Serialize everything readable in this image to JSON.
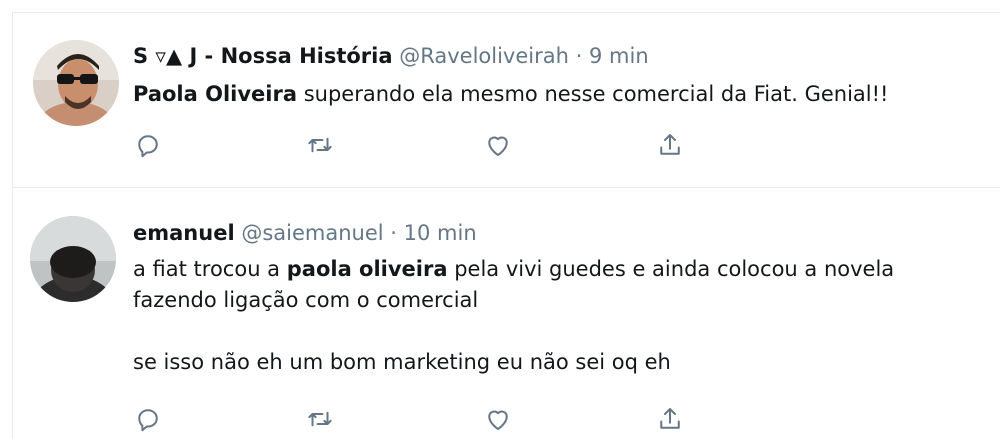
{
  "tweets": [
    {
      "display_name": "S ▿▲ J - Nossa História",
      "handle": "@Raveloliveirah",
      "separator": "·",
      "time": "9 min",
      "text_bold": "Paola Oliveira",
      "text_after": " superando ela mesmo nesse comercial da Fiat. Genial!!"
    },
    {
      "display_name": "emanuel",
      "handle": "@saiemanuel",
      "separator": "·",
      "time": "10 min",
      "text_before": "a fiat trocou a ",
      "text_bold": "paola oliveira",
      "text_after": " pela vivi guedes e ainda colocou a novela fazendo ligação com o comercial",
      "text_second": "se isso não eh um bom marketing eu não sei oq eh"
    }
  ],
  "icons": {
    "reply": "reply-icon",
    "retweet": "retweet-icon",
    "like": "heart-icon",
    "share": "share-icon"
  },
  "colors": {
    "icon": "#657786",
    "divider": "#e6ecf0",
    "text": "#14171a",
    "secondary": "#657786"
  }
}
